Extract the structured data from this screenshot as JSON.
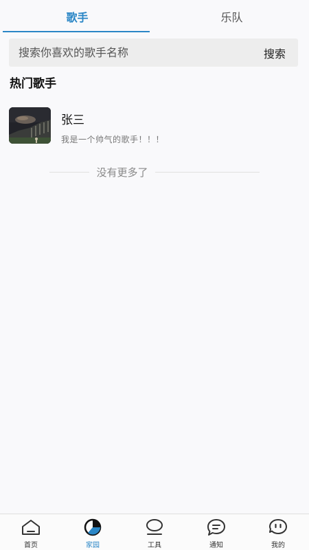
{
  "tabs": [
    {
      "label": "歌手",
      "active": true
    },
    {
      "label": "乐队",
      "active": false
    }
  ],
  "search": {
    "placeholder": "搜索你喜欢的歌手名称",
    "button_label": "搜索"
  },
  "section": {
    "title": "热门歌手"
  },
  "singers": [
    {
      "name": "张三",
      "description": "我是一个帅气的歌手！！！"
    }
  ],
  "list_end": {
    "text": "没有更多了"
  },
  "bottom_nav": {
    "items": [
      {
        "label": "首页",
        "icon": "home-icon",
        "active": false
      },
      {
        "label": "家园",
        "icon": "pie-chart-icon",
        "active": true
      },
      {
        "label": "工具",
        "icon": "tools-icon",
        "active": false
      },
      {
        "label": "通知",
        "icon": "message-icon",
        "active": false
      },
      {
        "label": "我的",
        "icon": "smiley-icon",
        "active": false
      }
    ]
  },
  "colors": {
    "accent": "#2a86c6",
    "background": "#f9f9fb",
    "search_bg": "#ededed"
  }
}
